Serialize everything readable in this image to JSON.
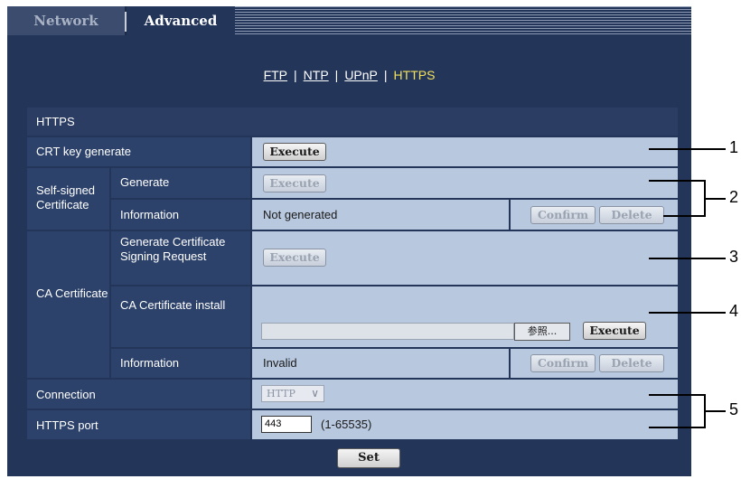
{
  "tabs": {
    "network": "Network",
    "advanced": "Advanced"
  },
  "subnav": {
    "ftp": "FTP",
    "ntp": "NTP",
    "upnp": "UPnP",
    "https": "HTTPS",
    "separator": "|"
  },
  "section_title": "HTTPS",
  "rows": {
    "crt_key": {
      "label": "CRT key generate",
      "button": "Execute"
    },
    "self_signed": {
      "group_label": "Self-signed Certificate",
      "generate_label": "Generate",
      "generate_button": "Execute",
      "information_label": "Information",
      "information_value": "Not generated",
      "confirm_button": "Confirm",
      "delete_button": "Delete"
    },
    "ca": {
      "group_label": "CA Certificate",
      "csr_label": "Generate Certificate Signing Request",
      "csr_button": "Execute",
      "install_label": "CA Certificate install",
      "browse_button": "参照...",
      "install_button": "Execute",
      "information_label": "Information",
      "information_value": "Invalid",
      "confirm_button": "Confirm",
      "delete_button": "Delete"
    },
    "connection": {
      "label": "Connection",
      "value": "HTTP"
    },
    "https_port": {
      "label": "HTTPS port",
      "value": "443",
      "range": "(1-65535)"
    }
  },
  "set_button": "Set",
  "callouts": [
    "1",
    "2",
    "3",
    "4",
    "5"
  ]
}
